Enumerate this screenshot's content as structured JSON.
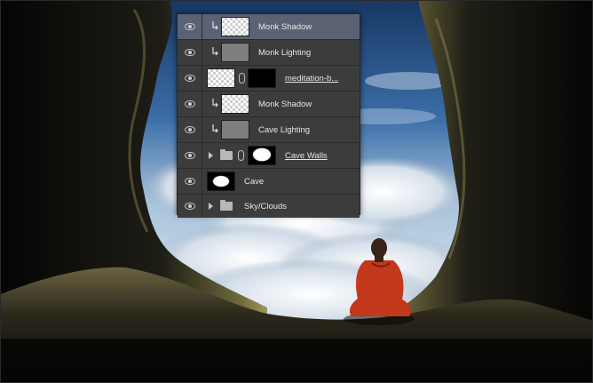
{
  "layers_panel": {
    "layers": [
      {
        "name": "Monk Shadow",
        "visible": true,
        "clipped": true,
        "selected": true,
        "thumb": "checker",
        "icon": "clipping-arrow-icon"
      },
      {
        "name": "Monk Lighting",
        "visible": true,
        "clipped": true,
        "selected": false,
        "thumb": "gray",
        "icon": "clipping-arrow-icon"
      },
      {
        "name": "meditation-b...",
        "visible": true,
        "clipped": false,
        "selected": false,
        "thumb": "checker",
        "mask": "black",
        "linked": true,
        "underlined": true,
        "icon": "link-chain-icon"
      },
      {
        "name": "Monk Shadow",
        "visible": true,
        "clipped": true,
        "selected": false,
        "thumb": "checker",
        "icon": "clipping-arrow-icon"
      },
      {
        "name": "Cave Lighting",
        "visible": true,
        "clipped": true,
        "selected": false,
        "thumb": "gray",
        "icon": "clipping-arrow-icon"
      },
      {
        "name": "Cave Walls",
        "visible": true,
        "clipped": false,
        "selected": false,
        "group": true,
        "mask": "black-white",
        "linked": true,
        "underlined": true,
        "icon": "folder-icon"
      },
      {
        "name": "Cave",
        "visible": true,
        "clipped": false,
        "selected": false,
        "thumb": "black-white"
      },
      {
        "name": "Sky/Clouds",
        "visible": true,
        "clipped": false,
        "selected": false,
        "group": true,
        "icon": "folder-icon"
      }
    ]
  },
  "colors": {
    "panel_bg": "#3c3c3c",
    "selected_row": "#5a6274",
    "sky_top": "#1e3f6e",
    "monk_robe": "#c2381a"
  }
}
